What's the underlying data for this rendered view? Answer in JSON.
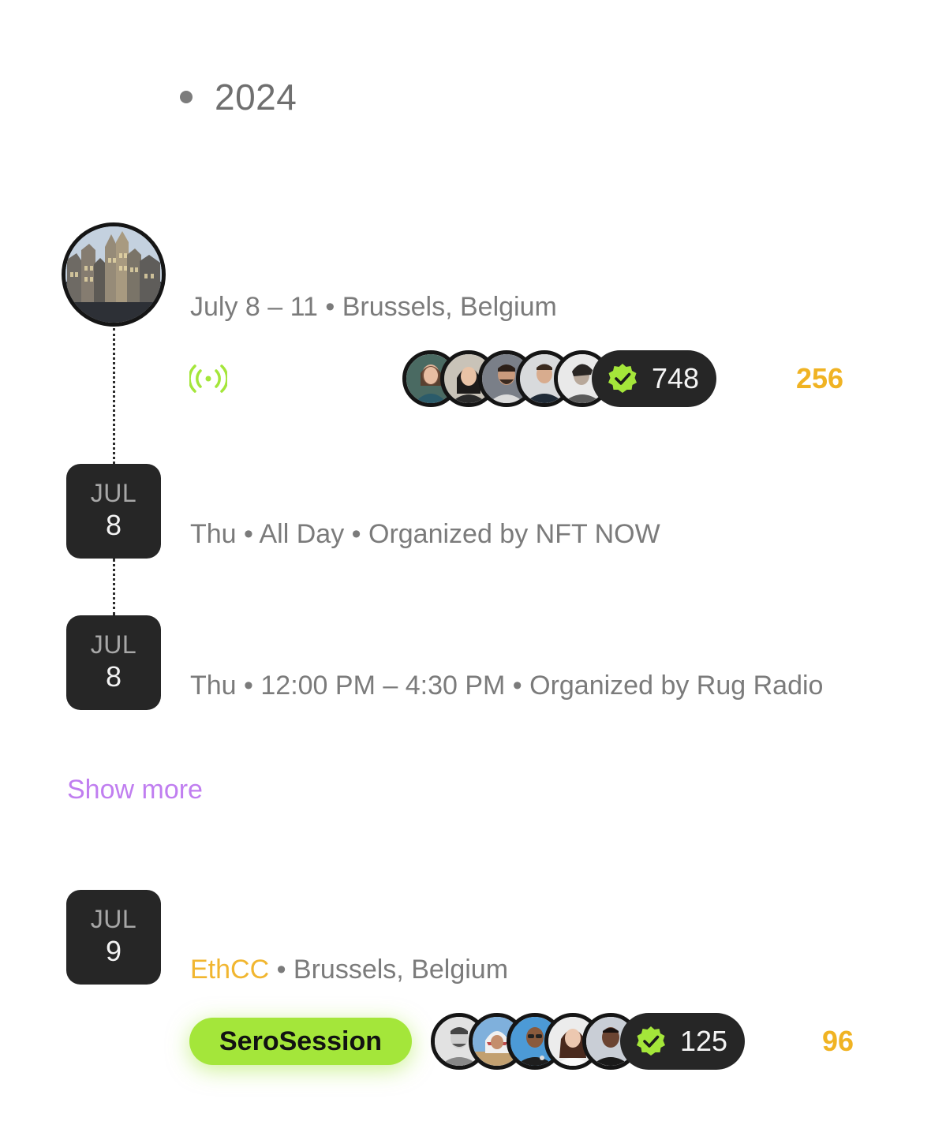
{
  "year": "2024",
  "featured": {
    "date_location": "July 8 – 11 • Brussels, Belgium",
    "live_icon": "live-broadcast-icon",
    "attendee_count": "748",
    "secondary_count": "256"
  },
  "events": [
    {
      "month": "JUL",
      "day": "8",
      "details": "Thu • All Day • Organized by NFT NOW"
    },
    {
      "month": "JUL",
      "day": "8",
      "details": "Thu • 12:00 PM – 4:30 PM • Organized by Rug Radio"
    }
  ],
  "show_more_label": "Show more",
  "ethcc_event": {
    "month": "JUL",
    "day": "9",
    "name": "EthCC",
    "location": " • Brussels, Belgium",
    "tag_label": "SeroSession",
    "attendee_count": "125",
    "secondary_count": "96"
  },
  "colors": {
    "accent_green": "#a4e63a",
    "gold": "#f0b323",
    "purple_link": "#c07ef0",
    "tile_dark": "#262626"
  }
}
